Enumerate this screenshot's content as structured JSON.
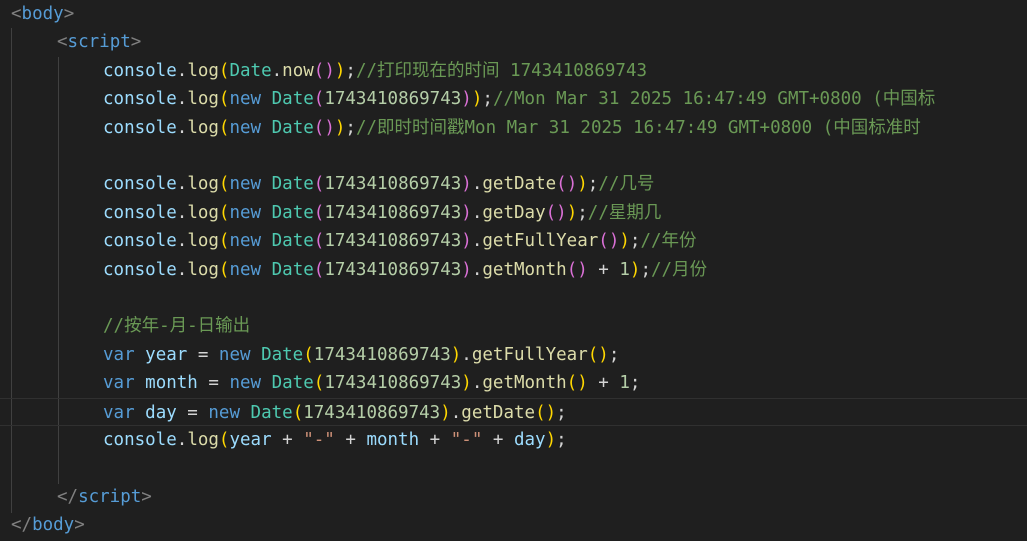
{
  "editor": {
    "language": "html",
    "theme": "dark",
    "colors": {
      "background": "#1f1f1f",
      "tag_bracket": "#808080",
      "tag_name": "#569cd6",
      "identifier": "#9cdcfe",
      "function": "#dcdcaa",
      "class": "#4ec9b0",
      "keyword": "#569cd6",
      "number": "#b5cea8",
      "string": "#ce9178",
      "comment": "#6a9955",
      "bracket_level_1": "#ffd700",
      "bracket_level_2": "#da70d6",
      "bracket_level_3": "#179fff"
    },
    "current_line": 14,
    "lines": [
      {
        "indent": 0,
        "tokens": [
          [
            "tag-br",
            "<"
          ],
          [
            "tag-name",
            "body"
          ],
          [
            "tag-br",
            ">"
          ]
        ]
      },
      {
        "indent": 4,
        "tokens": [
          [
            "tag-br",
            "<"
          ],
          [
            "tag-name",
            "script"
          ],
          [
            "tag-br",
            ">"
          ]
        ]
      },
      {
        "indent": 8,
        "tokens": [
          [
            "id",
            "console"
          ],
          [
            "pun",
            "."
          ],
          [
            "fn",
            "log"
          ],
          [
            "p1",
            "("
          ],
          [
            "cls",
            "Date"
          ],
          [
            "pun",
            "."
          ],
          [
            "fn",
            "now"
          ],
          [
            "p2",
            "()"
          ],
          [
            "p1",
            ")"
          ],
          [
            "pun",
            ";"
          ],
          [
            "cmt",
            "//打印现在的时间 1743410869743"
          ]
        ]
      },
      {
        "indent": 8,
        "tokens": [
          [
            "id",
            "console"
          ],
          [
            "pun",
            "."
          ],
          [
            "fn",
            "log"
          ],
          [
            "p1",
            "("
          ],
          [
            "kw",
            "new "
          ],
          [
            "cls",
            "Date"
          ],
          [
            "p2",
            "("
          ],
          [
            "num",
            "1743410869743"
          ],
          [
            "p2",
            ")"
          ],
          [
            "p1",
            ")"
          ],
          [
            "pun",
            ";"
          ],
          [
            "cmt",
            "//Mon Mar 31 2025 16:47:49 GMT+0800 (中国标"
          ]
        ]
      },
      {
        "indent": 8,
        "tokens": [
          [
            "id",
            "console"
          ],
          [
            "pun",
            "."
          ],
          [
            "fn",
            "log"
          ],
          [
            "p1",
            "("
          ],
          [
            "kw",
            "new "
          ],
          [
            "cls",
            "Date"
          ],
          [
            "p2",
            "()"
          ],
          [
            "p1",
            ")"
          ],
          [
            "pun",
            ";"
          ],
          [
            "cmt",
            "//即时时间戳Mon Mar 31 2025 16:47:49 GMT+0800 (中国标准时"
          ]
        ]
      },
      {
        "indent": 0,
        "tokens": []
      },
      {
        "indent": 8,
        "tokens": [
          [
            "id",
            "console"
          ],
          [
            "pun",
            "."
          ],
          [
            "fn",
            "log"
          ],
          [
            "p1",
            "("
          ],
          [
            "kw",
            "new "
          ],
          [
            "cls",
            "Date"
          ],
          [
            "p2",
            "("
          ],
          [
            "num",
            "1743410869743"
          ],
          [
            "p2",
            ")"
          ],
          [
            "pun",
            "."
          ],
          [
            "fn",
            "getDate"
          ],
          [
            "p2",
            "()"
          ],
          [
            "p1",
            ")"
          ],
          [
            "pun",
            ";"
          ],
          [
            "cmt",
            "//几号"
          ]
        ]
      },
      {
        "indent": 8,
        "tokens": [
          [
            "id",
            "console"
          ],
          [
            "pun",
            "."
          ],
          [
            "fn",
            "log"
          ],
          [
            "p1",
            "("
          ],
          [
            "kw",
            "new "
          ],
          [
            "cls",
            "Date"
          ],
          [
            "p2",
            "("
          ],
          [
            "num",
            "1743410869743"
          ],
          [
            "p2",
            ")"
          ],
          [
            "pun",
            "."
          ],
          [
            "fn",
            "getDay"
          ],
          [
            "p2",
            "()"
          ],
          [
            "p1",
            ")"
          ],
          [
            "pun",
            ";"
          ],
          [
            "cmt",
            "//星期几"
          ]
        ]
      },
      {
        "indent": 8,
        "tokens": [
          [
            "id",
            "console"
          ],
          [
            "pun",
            "."
          ],
          [
            "fn",
            "log"
          ],
          [
            "p1",
            "("
          ],
          [
            "kw",
            "new "
          ],
          [
            "cls",
            "Date"
          ],
          [
            "p2",
            "("
          ],
          [
            "num",
            "1743410869743"
          ],
          [
            "p2",
            ")"
          ],
          [
            "pun",
            "."
          ],
          [
            "fn",
            "getFullYear"
          ],
          [
            "p2",
            "()"
          ],
          [
            "p1",
            ")"
          ],
          [
            "pun",
            ";"
          ],
          [
            "cmt",
            "//年份"
          ]
        ]
      },
      {
        "indent": 8,
        "tokens": [
          [
            "id",
            "console"
          ],
          [
            "pun",
            "."
          ],
          [
            "fn",
            "log"
          ],
          [
            "p1",
            "("
          ],
          [
            "kw",
            "new "
          ],
          [
            "cls",
            "Date"
          ],
          [
            "p2",
            "("
          ],
          [
            "num",
            "1743410869743"
          ],
          [
            "p2",
            ")"
          ],
          [
            "pun",
            "."
          ],
          [
            "fn",
            "getMonth"
          ],
          [
            "p2",
            "()"
          ],
          [
            "pun",
            " + "
          ],
          [
            "num",
            "1"
          ],
          [
            "p1",
            ")"
          ],
          [
            "pun",
            ";"
          ],
          [
            "cmt",
            "//月份"
          ]
        ]
      },
      {
        "indent": 0,
        "tokens": []
      },
      {
        "indent": 8,
        "tokens": [
          [
            "cmt",
            "//按年-月-日输出"
          ]
        ]
      },
      {
        "indent": 8,
        "tokens": [
          [
            "kw",
            "var "
          ],
          [
            "id",
            "year"
          ],
          [
            "pun",
            " = "
          ],
          [
            "kw",
            "new "
          ],
          [
            "cls",
            "Date"
          ],
          [
            "p1",
            "("
          ],
          [
            "num",
            "1743410869743"
          ],
          [
            "p1",
            ")"
          ],
          [
            "pun",
            "."
          ],
          [
            "fn",
            "getFullYear"
          ],
          [
            "p1",
            "()"
          ],
          [
            "pun",
            ";"
          ]
        ]
      },
      {
        "indent": 8,
        "tokens": [
          [
            "kw",
            "var "
          ],
          [
            "id",
            "month"
          ],
          [
            "pun",
            " = "
          ],
          [
            "kw",
            "new "
          ],
          [
            "cls",
            "Date"
          ],
          [
            "p1",
            "("
          ],
          [
            "num",
            "1743410869743"
          ],
          [
            "p1",
            ")"
          ],
          [
            "pun",
            "."
          ],
          [
            "fn",
            "getMonth"
          ],
          [
            "p1",
            "()"
          ],
          [
            "pun",
            " + "
          ],
          [
            "num",
            "1"
          ],
          [
            "pun",
            ";"
          ]
        ]
      },
      {
        "indent": 8,
        "tokens": [
          [
            "kw",
            "var "
          ],
          [
            "id",
            "day"
          ],
          [
            "pun",
            " = "
          ],
          [
            "kw",
            "new "
          ],
          [
            "cls",
            "Date"
          ],
          [
            "p1",
            "("
          ],
          [
            "num",
            "1743410869743"
          ],
          [
            "p1",
            ")"
          ],
          [
            "pun",
            "."
          ],
          [
            "fn",
            "getDate"
          ],
          [
            "p1",
            "()"
          ],
          [
            "pun",
            ";"
          ]
        ]
      },
      {
        "indent": 8,
        "tokens": [
          [
            "id",
            "console"
          ],
          [
            "pun",
            "."
          ],
          [
            "fn",
            "log"
          ],
          [
            "p1",
            "("
          ],
          [
            "id",
            "year"
          ],
          [
            "pun",
            " + "
          ],
          [
            "str",
            "\"-\""
          ],
          [
            "pun",
            " + "
          ],
          [
            "id",
            "month"
          ],
          [
            "pun",
            " + "
          ],
          [
            "str",
            "\"-\""
          ],
          [
            "pun",
            " + "
          ],
          [
            "id",
            "day"
          ],
          [
            "p1",
            ")"
          ],
          [
            "pun",
            ";"
          ]
        ]
      },
      {
        "indent": 0,
        "tokens": []
      },
      {
        "indent": 4,
        "tokens": [
          [
            "tag-br",
            "</"
          ],
          [
            "tag-name",
            "script"
          ],
          [
            "tag-br",
            ">"
          ]
        ]
      },
      {
        "indent": 0,
        "tokens": [
          [
            "tag-br",
            "</"
          ],
          [
            "tag-name",
            "body"
          ],
          [
            "tag-br",
            ">"
          ]
        ]
      }
    ]
  }
}
